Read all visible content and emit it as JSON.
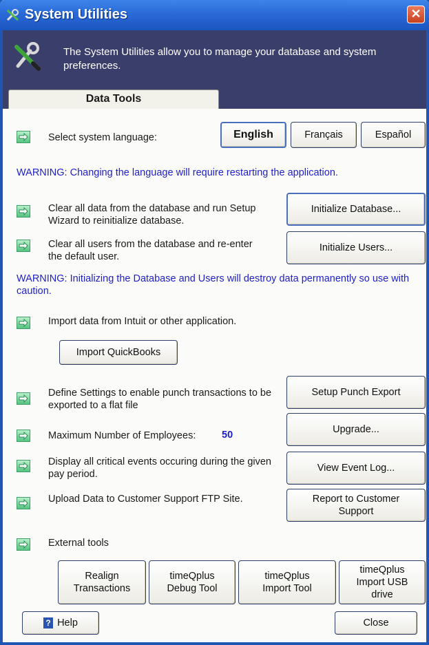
{
  "window": {
    "title": "System Utilities",
    "close_glyph": "✕"
  },
  "banner": {
    "text": "The System Utilities allow you to manage your database and system preferences."
  },
  "tabs": [
    {
      "label": "Data Tools",
      "selected": true
    }
  ],
  "language": {
    "label": "Select system language:",
    "options": [
      "English",
      "Français",
      "Español"
    ],
    "selected": "English"
  },
  "warnings": {
    "language": "WARNING:  Changing the language will require restarting the application.",
    "database": "WARNING:  Initializing the Database and Users will destroy data permanently so use with caution."
  },
  "database": {
    "label": "Clear all data from the database and run Setup Wizard to reinitialize database.",
    "button": "Initialize Database..."
  },
  "users": {
    "label": "Clear all users from the  database and re-enter the default user.",
    "button": "Initialize Users..."
  },
  "import": {
    "label": "Import data from Intuit or other application.",
    "button": "Import QuickBooks"
  },
  "punch_export": {
    "label": "Define Settings to enable punch transactions to be exported to a flat file",
    "button": "Setup Punch Export"
  },
  "employees": {
    "label": "Maximum Number of Employees:",
    "value": "50",
    "button": "Upgrade..."
  },
  "event_log": {
    "label": "Display all critical events occuring during the given pay period.",
    "button": "View Event Log..."
  },
  "support": {
    "label": "Upload Data to Customer Support FTP Site.",
    "button": "Report to Customer Support"
  },
  "external": {
    "label": "External tools",
    "buttons": [
      "Realign Transactions",
      "timeQplus Debug Tool",
      "timeQplus Import Tool",
      "timeQplus Import USB drive"
    ]
  },
  "footer": {
    "help_label": "Help",
    "help_glyph": "?",
    "close_label": "Close"
  },
  "colors": {
    "titlebar": "#2a6ad8",
    "banner": "#3a3e6a",
    "warning_text": "#1e1ec8",
    "arrow_icon": "#54c482"
  },
  "icons": [
    "tools-icon",
    "close-icon",
    "arrow-right-icon",
    "help-icon"
  ]
}
